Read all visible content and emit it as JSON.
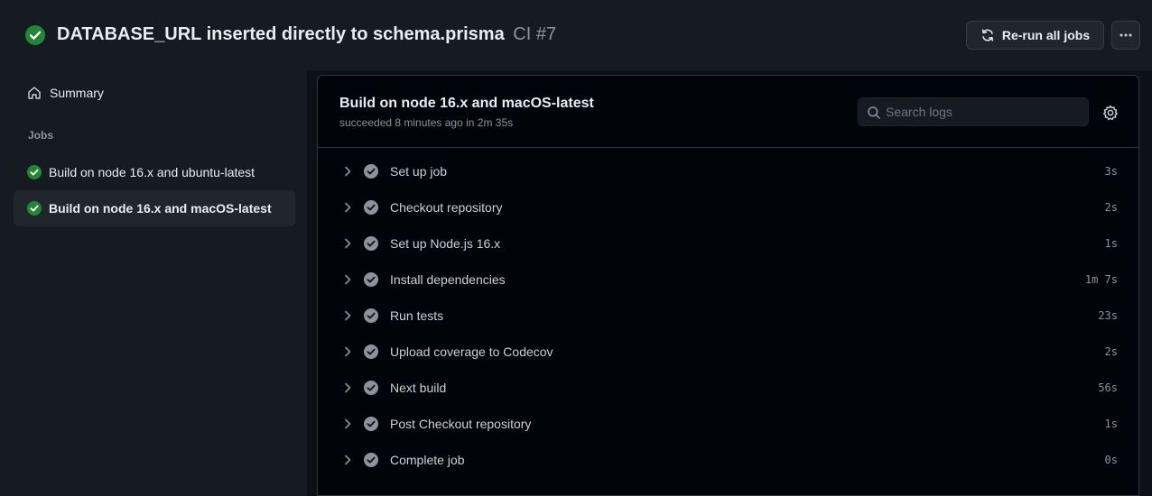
{
  "header": {
    "status_icon": "check-circle-icon",
    "title": "DATABASE_URL inserted directly to schema.prisma",
    "workflow": "CI #7",
    "rerun_label": "Re-run all jobs",
    "more_icon": "kebab-horizontal-icon"
  },
  "sidebar": {
    "summary_label": "Summary",
    "summary_icon": "home-icon",
    "jobs_heading": "Jobs",
    "jobs": [
      {
        "label": "Build on node 16.x and ubuntu-latest",
        "status": "success",
        "active": false
      },
      {
        "label": "Build on node 16.x and macOS-latest",
        "status": "success",
        "active": true
      }
    ]
  },
  "job": {
    "title": "Build on node 16.x and macOS-latest",
    "subtitle": "succeeded 8 minutes ago in 2m 35s",
    "search_placeholder": "Search logs",
    "settings_icon": "gear-icon"
  },
  "steps": [
    {
      "name": "Set up job",
      "duration": "3s"
    },
    {
      "name": "Checkout repository",
      "duration": "2s"
    },
    {
      "name": "Set up Node.js 16.x",
      "duration": "1s"
    },
    {
      "name": "Install dependencies",
      "duration": "1m 7s"
    },
    {
      "name": "Run tests",
      "duration": "23s"
    },
    {
      "name": "Upload coverage to Codecov",
      "duration": "2s"
    },
    {
      "name": "Next build",
      "duration": "56s"
    },
    {
      "name": "Post Checkout repository",
      "duration": "1s"
    },
    {
      "name": "Complete job",
      "duration": "0s"
    }
  ],
  "colors": {
    "success": "#238636",
    "step_check": "#8b949e",
    "background": "#0d1117",
    "panel": "#010409"
  }
}
